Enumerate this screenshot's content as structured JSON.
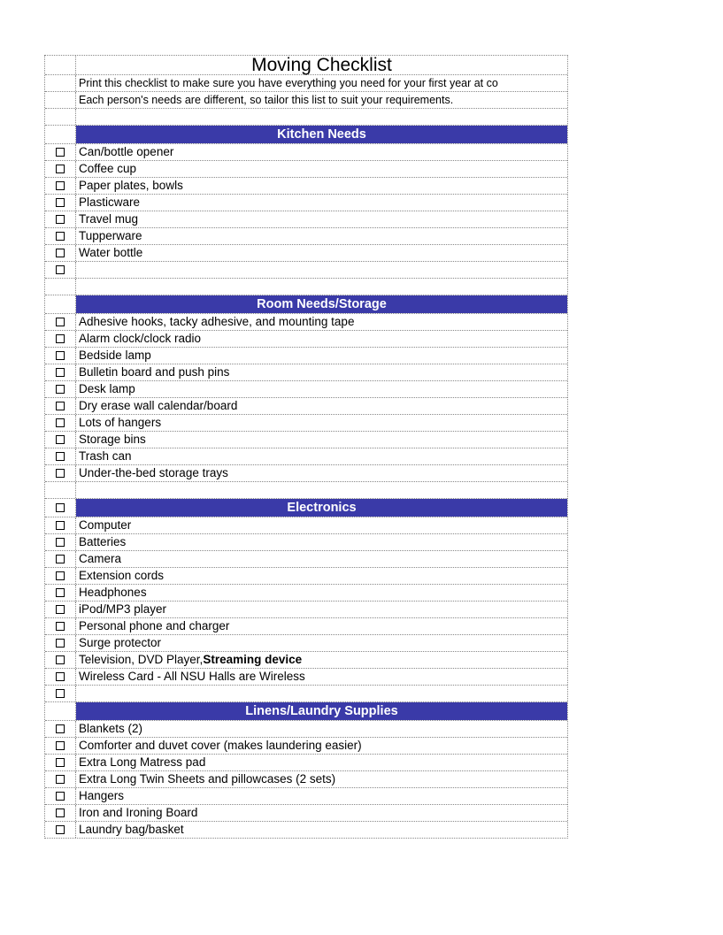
{
  "title": "Moving Checklist",
  "intro": [
    "Print this checklist to make sure you have everything you need for your first year at co",
    "Each person's needs are different, so tailor this list to suit your requirements."
  ],
  "sections": [
    {
      "header": "Kitchen Needs",
      "items": [
        "Can/bottle opener",
        "Coffee cup",
        "Paper plates, bowls",
        "Plasticware",
        "Travel mug",
        "Tupperware",
        "Water bottle"
      ]
    },
    {
      "header": "Room Needs/Storage",
      "items": [
        "Adhesive hooks, tacky adhesive, and mounting tape",
        "Alarm clock/clock radio",
        "Bedside lamp",
        "Bulletin board and push pins",
        "Desk lamp",
        "Dry erase wall calendar/board",
        "Lots of hangers",
        "Storage bins",
        "Trash can",
        "Under-the-bed storage trays"
      ]
    },
    {
      "header": "Electronics",
      "items": [
        "Computer",
        "Batteries",
        "Camera",
        "Extension cords",
        "Headphones",
        "iPod/MP3 player",
        "Personal phone and charger",
        "Surge protector"
      ],
      "special_item": {
        "prefix": "Television, DVD Player, ",
        "bold": "Streaming device"
      },
      "items_after": [
        "Wireless Card - All NSU Halls are Wireless"
      ]
    },
    {
      "header": "Linens/Laundry Supplies",
      "items": [
        "Blankets (2)",
        "Comforter and duvet cover (makes laundering easier)",
        "Extra Long Matress pad",
        "Extra Long Twin Sheets and pillowcases (2 sets)",
        "Hangers",
        "Iron and Ironing Board",
        "Laundry bag/basket"
      ]
    }
  ]
}
